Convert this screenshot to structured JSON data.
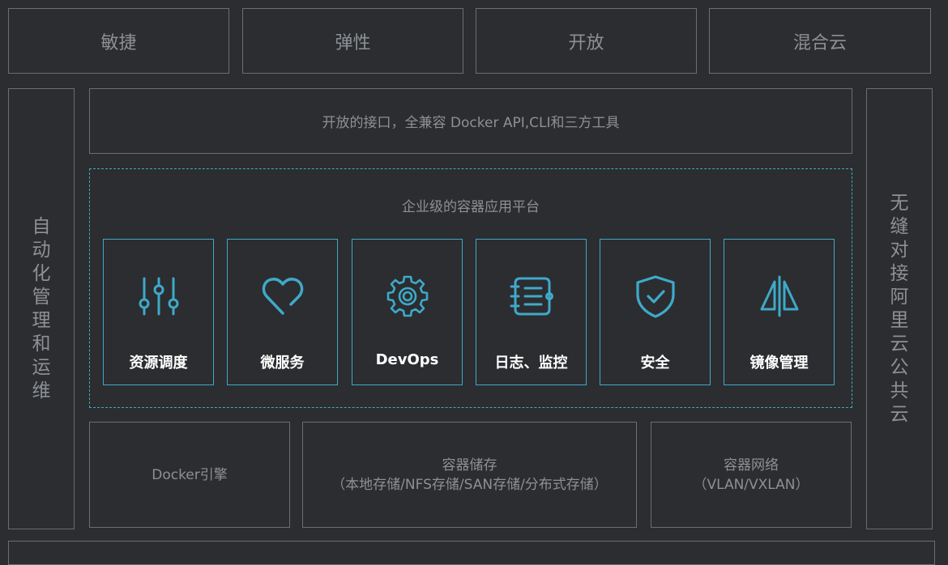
{
  "top_row": [
    "敏捷",
    "弹性",
    "开放",
    "混合云"
  ],
  "left_column": [
    "自",
    "动",
    "化",
    "管",
    "理",
    "和",
    "运",
    "维"
  ],
  "right_column": [
    "无",
    "缝",
    "对",
    "接",
    "阿",
    "里",
    "云",
    "公",
    "共",
    "云"
  ],
  "api_bar": "开放的接口，全兼容 Docker API,CLI和三方工具",
  "platform": {
    "title": "企业级的容器应用平台",
    "cards": [
      {
        "label": "资源调度",
        "icon": "sliders-icon"
      },
      {
        "label": "微服务",
        "icon": "heart-icon"
      },
      {
        "label": "DevOps",
        "icon": "gear-icon"
      },
      {
        "label": "日志、监控",
        "icon": "log-icon"
      },
      {
        "label": "安全",
        "icon": "shield-check-icon"
      },
      {
        "label": "镜像管理",
        "icon": "mirror-icon"
      }
    ]
  },
  "bottom_row": {
    "engine": "Docker引擎",
    "storage_title": "容器储存",
    "storage_detail": "（本地存储/NFS存储/SAN存储/分布式存储）",
    "network_title": "容器网络",
    "network_detail": "（VLAN/VXLAN）"
  },
  "colors": {
    "background": "#2b2d30",
    "border": "#6b6e72",
    "accent": "#3fa9c9",
    "text": "#8d9094"
  }
}
